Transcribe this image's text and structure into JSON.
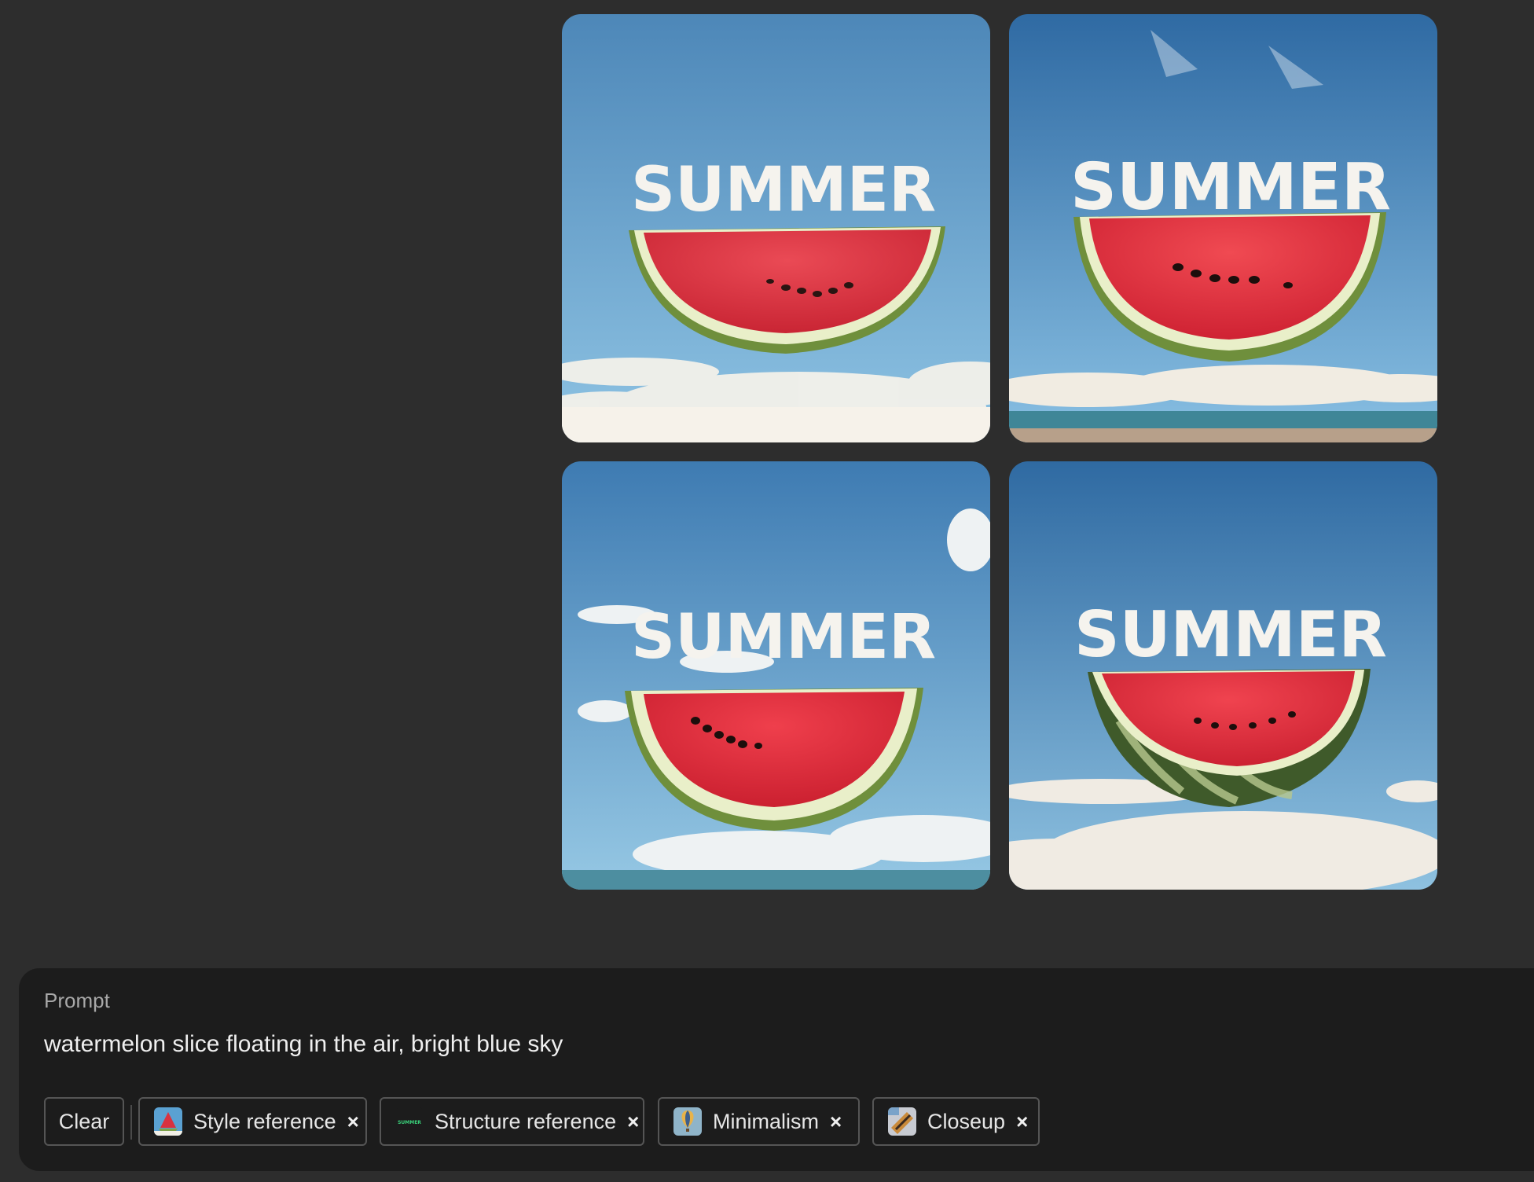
{
  "results": {
    "images": [
      {
        "headline": "SUMMER"
      },
      {
        "headline": "SUMMER"
      },
      {
        "headline": "SUMMER"
      },
      {
        "headline": "SUMMER"
      }
    ]
  },
  "prompt": {
    "label": "Prompt",
    "text": "watermelon slice floating in the air, bright blue sky"
  },
  "actions": {
    "clear_label": "Clear"
  },
  "chips": [
    {
      "label": "Style reference",
      "icon": "watermelon-thumbnail",
      "remove": "×"
    },
    {
      "label": "Structure reference",
      "icon": "summer-text-thumbnail",
      "thumb_text": "SUMMER",
      "remove": "×"
    },
    {
      "label": "Minimalism",
      "icon": "balloon-thumbnail",
      "remove": "×"
    },
    {
      "label": "Closeup",
      "icon": "closeup-thumbnail",
      "remove": "×"
    }
  ],
  "colors": {
    "background": "#2d2d2d",
    "panel": "#1c1c1c",
    "sky_top": "#3f7fb6",
    "sky_bottom": "#8fc4e6",
    "melon_flesh": "#d9323f",
    "melon_rind": "#7fa34a"
  }
}
